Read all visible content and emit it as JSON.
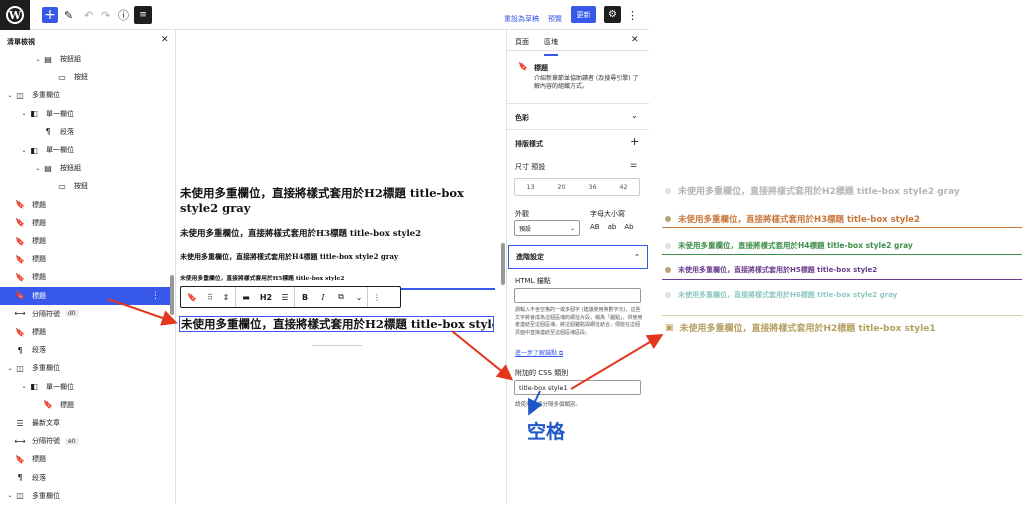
{
  "topbar": {
    "logo": "W",
    "plus_icon": "+",
    "list_view_icon": "≡",
    "switch_to_draft": "重設為草稿",
    "preview": "預覽",
    "update": "更新",
    "gear_icon": "⚙",
    "more_icon": "⋮"
  },
  "list_view": {
    "title": "清單檢視",
    "close": "✕",
    "items": [
      {
        "label": "按鈕組",
        "depth": 2,
        "chev": "⌄",
        "icon": "▤"
      },
      {
        "label": "按鈕",
        "depth": 3,
        "chev": "",
        "icon": "▭"
      },
      {
        "label": "多重欄位",
        "depth": 0,
        "chev": "⌄",
        "icon": "◫"
      },
      {
        "label": "單一欄位",
        "depth": 1,
        "chev": "⌄",
        "icon": "◧"
      },
      {
        "label": "段落",
        "depth": 2,
        "chev": "",
        "icon": "¶"
      },
      {
        "label": "單一欄位",
        "depth": 1,
        "chev": "⌄",
        "icon": "◧"
      },
      {
        "label": "按鈕組",
        "depth": 2,
        "chev": "⌄",
        "icon": "▤"
      },
      {
        "label": "按鈕",
        "depth": 3,
        "chev": "",
        "icon": "▭"
      },
      {
        "label": "標題",
        "depth": 0,
        "chev": "",
        "icon": "🔖"
      },
      {
        "label": "標題",
        "depth": 0,
        "chev": "",
        "icon": "🔖"
      },
      {
        "label": "標題",
        "depth": 0,
        "chev": "",
        "icon": "🔖"
      },
      {
        "label": "標題",
        "depth": 0,
        "chev": "",
        "icon": "🔖"
      },
      {
        "label": "標題",
        "depth": 0,
        "chev": "",
        "icon": "🔖"
      },
      {
        "label": "標題",
        "depth": 0,
        "chev": "",
        "icon": "🔖",
        "selected": true
      },
      {
        "label": "分隔符號",
        "depth": 0,
        "chev": "",
        "icon": "⟷",
        "tag": "d0"
      },
      {
        "label": "標題",
        "depth": 0,
        "chev": "",
        "icon": "🔖"
      },
      {
        "label": "段落",
        "depth": 0,
        "chev": "",
        "icon": "¶"
      },
      {
        "label": "多重欄位",
        "depth": 0,
        "chev": "⌄",
        "icon": "◫"
      },
      {
        "label": "單一欄位",
        "depth": 1,
        "chev": "⌄",
        "icon": "◧"
      },
      {
        "label": "標題",
        "depth": 2,
        "chev": "",
        "icon": "🔖"
      },
      {
        "label": "最新文章",
        "depth": 0,
        "chev": "",
        "icon": "☰"
      },
      {
        "label": "分隔符號",
        "depth": 0,
        "chev": "",
        "icon": "⟷",
        "tag": "e0"
      },
      {
        "label": "標題",
        "depth": 0,
        "chev": "",
        "icon": "🔖"
      },
      {
        "label": "段落",
        "depth": 0,
        "chev": "",
        "icon": "¶"
      },
      {
        "label": "多重欄位",
        "depth": 0,
        "chev": "⌄",
        "icon": "◫"
      }
    ]
  },
  "canvas": {
    "h2_gray": "未使用多重欄位，直接將樣式套用於H2標題 title-box style2 gray",
    "h3": "未使用多重欄位，直接將樣式套用於H3標題 title-box style2",
    "h4": "未使用多重欄位，直接將樣式套用於H4標題 title-box style2 gray",
    "h5": "未使用多重欄位，直接將樣式套用於H5標題 title-box style2",
    "h2_style1": "未使用多重欄位，直接將樣式套用於H2標題 title-box style1",
    "toolbar": {
      "bookmark_icon": "🔖",
      "drag_icon": "⠿",
      "move_icon": "⇕",
      "align_icon": "▬",
      "level": "H2",
      "text_align_icon": "☰",
      "bold": "B",
      "italic": "I",
      "link_icon": "⧉",
      "dropdown_icon": "⌄",
      "more_icon": "⋮"
    }
  },
  "settings": {
    "tab_page": "頁面",
    "tab_block": "區塊",
    "close": "✕",
    "block_name": "標題",
    "block_desc": "介紹新章節並協助讀者 (及搜尋引擎) 了解內容的組織方式。",
    "color": "色彩",
    "typography": "排版樣式",
    "size_label": "尺寸 預設",
    "sizes": [
      "13",
      "20",
      "36",
      "42"
    ],
    "appearance": "外觀",
    "appearance_value": "預設",
    "letter_case": "字母大小寫",
    "case_options": [
      "AB",
      "ab",
      "Ab"
    ],
    "advanced": "進階設定",
    "html_anchor": "HTML 錨點",
    "anchor_help": "請輸入不含空格的一或多個字 (建議使用英數字元)，這些文字將會成為這個區塊的網址片段，稱為「錨點」，供使用者連結至這個區塊。將這個錨點與網址結合，便能在這個頁面中直接連結至這個區塊區段。",
    "learn_more": "進一步了解錨點",
    "css_class_label": "附加的 CSS 類別",
    "css_class_value": "title-box style1",
    "css_help": "請使用空格分隔多個類別。",
    "annotation": "空格"
  },
  "samples": [
    {
      "text": "未使用多重欄位，直接將樣式套用於H2標題 title-box style2 gray",
      "color": "#b5b5b5",
      "dot": "#e0e0e0"
    },
    {
      "text": "未使用多重欄位，直接將樣式套用於H3標題 title-box style2",
      "color": "#c8763a",
      "dot": "#b5a47a"
    },
    {
      "text": "未使用多重欄位，直接將樣式套用於H4標題 title-box style2 gray",
      "color": "#3f8f4a",
      "dot": "#e0e0e0"
    },
    {
      "text": "未使用多重欄位，直接將樣式套用於H5標題 title-box style2",
      "color": "#6a3d8f",
      "dot": "#b5a47a"
    },
    {
      "text": "未使用多重欄位，直接將樣式套用於H6標題 title-box style2 gray",
      "color": "#8fc7c2",
      "dot": "#e0e0e0"
    },
    {
      "text": "未使用多重欄位，直接將樣式套用於H2標題 title-box style1",
      "color": "#b5a061",
      "dot": ""
    }
  ],
  "colors": {
    "accent": "#3858e9",
    "arrow": "#e2361d",
    "annotation": "#1f56c8"
  }
}
